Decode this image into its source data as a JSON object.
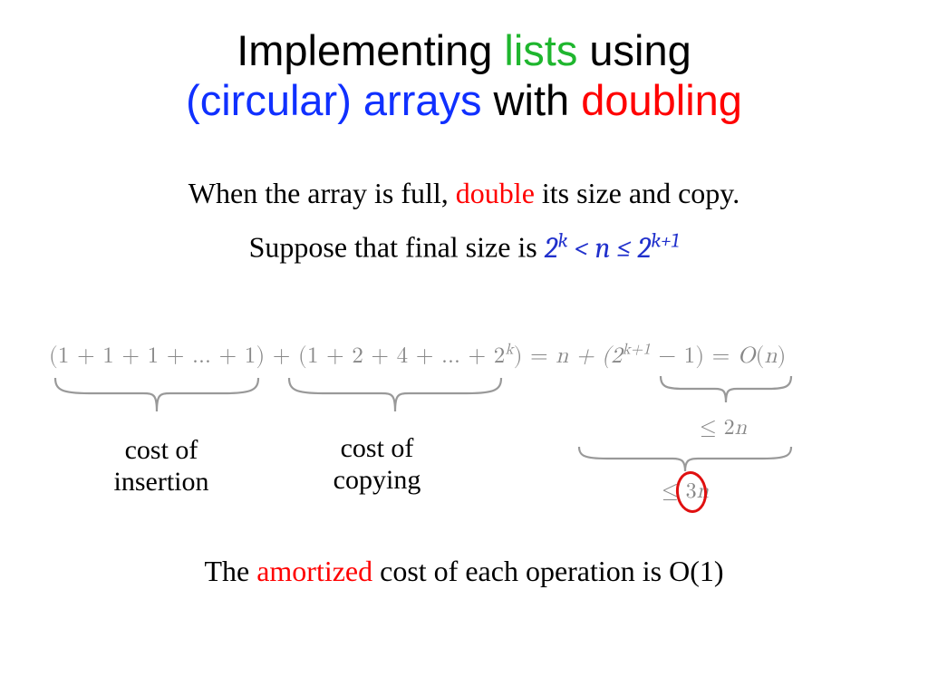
{
  "title": {
    "w1": "Implementing ",
    "w2": "lists",
    "w3": " using",
    "w4": "(circular) arrays",
    "w5": " with ",
    "w6": "doubling"
  },
  "sub1": {
    "a": "When the array is full, ",
    "b": "double",
    "c": " its size and copy."
  },
  "sub2": {
    "a": "Suppose that final size is ",
    "math": "2ᵏ < n ≤ 2ᵏ⁺¹"
  },
  "equation": {
    "lhs1": "(1 + 1 + 1 + … + 1)",
    "plus": " + ",
    "lhs2_open": "(1 + 2 + 4 + … + 2",
    "lhs2_exp": "k",
    "lhs2_close": ")",
    "eq1": "  =  ",
    "mid_a": "n + (2",
    "mid_exp": "k+1",
    "mid_b": " − 1)",
    "eq2": "  =  ",
    "rhs": "O(n)"
  },
  "labels": {
    "insertion": "cost of\ninsertion",
    "copying": "cost of\ncopying",
    "le2n_a": "≤ 2",
    "le2n_b": "n",
    "le3n_a": "≤ 3",
    "le3n_b": "n"
  },
  "bottom": {
    "a": "The ",
    "b": "amortized",
    "c": " cost of each operation is O(1)"
  }
}
